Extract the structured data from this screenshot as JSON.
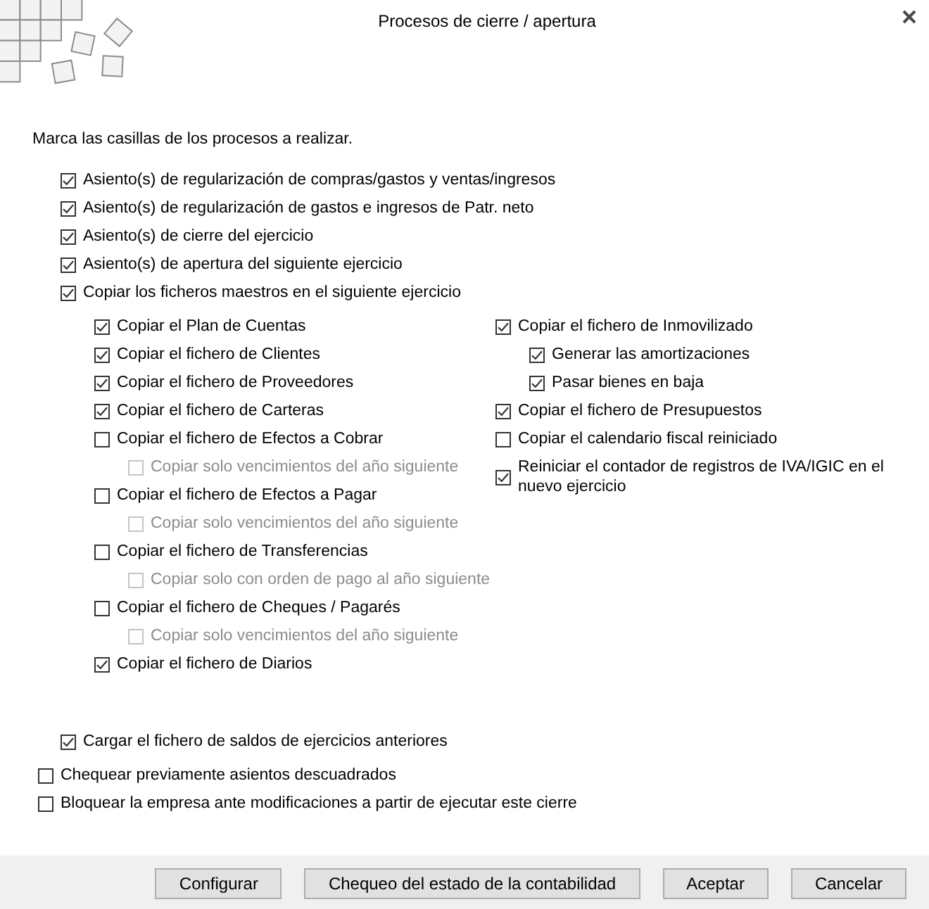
{
  "window": {
    "title": "Procesos de cierre / apertura"
  },
  "instructions": "Marca las casillas de los procesos a realizar.",
  "processes": [
    {
      "label": "Asiento(s) de regularización de compras/gastos y ventas/ingresos",
      "checked": true
    },
    {
      "label": "Asiento(s) de regularización de gastos e ingresos de Patr. neto",
      "checked": true
    },
    {
      "label": "Asiento(s) de cierre del ejercicio",
      "checked": true
    },
    {
      "label": "Asiento(s) de apertura del siguiente ejercicio",
      "checked": true
    },
    {
      "label": "Copiar los ficheros maestros en el siguiente ejercicio",
      "checked": true
    }
  ],
  "master_files": {
    "left": [
      {
        "label": "Copiar el Plan de Cuentas",
        "checked": true
      },
      {
        "label": "Copiar el fichero de Clientes",
        "checked": true
      },
      {
        "label": "Copiar el fichero de Proveedores",
        "checked": true
      },
      {
        "label": "Copiar el fichero de Carteras",
        "checked": true
      },
      {
        "label": "Copiar el fichero de Efectos a Cobrar",
        "checked": false,
        "children": [
          {
            "label": "Copiar solo vencimientos del año siguiente",
            "checked": false,
            "disabled": true
          }
        ]
      },
      {
        "label": "Copiar el fichero de Efectos a Pagar",
        "checked": false,
        "children": [
          {
            "label": "Copiar solo vencimientos del año siguiente",
            "checked": false,
            "disabled": true
          }
        ]
      },
      {
        "label": "Copiar el fichero de Transferencias",
        "checked": false,
        "children": [
          {
            "label": "Copiar solo con orden de pago al año siguiente",
            "checked": false,
            "disabled": true
          }
        ]
      },
      {
        "label": "Copiar el fichero de Cheques / Pagarés",
        "checked": false,
        "children": [
          {
            "label": "Copiar solo vencimientos del año siguiente",
            "checked": false,
            "disabled": true
          }
        ]
      },
      {
        "label": "Copiar el fichero de Diarios",
        "checked": true
      }
    ],
    "right": [
      {
        "label": "Copiar el fichero de Inmovilizado",
        "checked": true,
        "children": [
          {
            "label": "Generar las amortizaciones",
            "checked": true,
            "disabled": false
          },
          {
            "label": "Pasar bienes en baja",
            "checked": true,
            "disabled": false
          }
        ]
      },
      {
        "label": "Copiar el fichero de Presupuestos",
        "checked": true
      },
      {
        "label": "Copiar el calendario fiscal reiniciado",
        "checked": false
      },
      {
        "label": "Reiniciar el contador de registros de IVA/IGIC en el nuevo ejercicio",
        "checked": true
      }
    ]
  },
  "balances": {
    "label": "Cargar el fichero de saldos de ejercicios anteriores",
    "checked": true
  },
  "options": [
    {
      "label": "Chequear previamente asientos descuadrados",
      "checked": false
    },
    {
      "label": "Bloquear la empresa ante modificaciones a partir de ejecutar este cierre",
      "checked": false
    }
  ],
  "buttons": [
    "Configurar",
    "Chequeo del estado de la contabilidad",
    "Aceptar",
    "Cancelar"
  ]
}
